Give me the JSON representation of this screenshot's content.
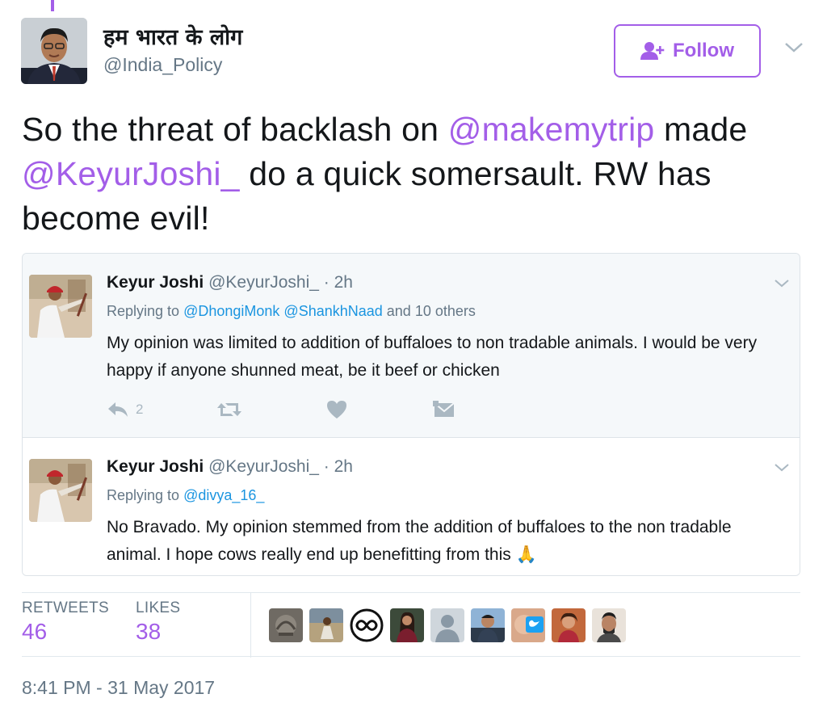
{
  "header": {
    "display_name": "हम भारत के लोग",
    "handle": "@India_Policy",
    "follow_label": "Follow"
  },
  "tweet": {
    "part1": "So the threat of backlash on ",
    "mention1": "@makemytrip",
    "part2": " made ",
    "mention2": "@KeyurJoshi_",
    "part3": " do a quick somersault. RW has become evil!"
  },
  "quoted": [
    {
      "name": "Keyur Joshi",
      "handle": "@KeyurJoshi_",
      "time": "· 2h",
      "replying_prefix": "Replying to ",
      "reply_link1": "@DhongiMonk",
      "reply_link2": "@ShankhNaad",
      "reply_suffix": " and 10 others",
      "text": "My opinion was limited to addition of buffaloes to non tradable animals. I would be very happy if anyone shunned meat, be it beef or chicken",
      "reply_count": "2"
    },
    {
      "name": "Keyur Joshi",
      "handle": "@KeyurJoshi_",
      "time": "· 2h",
      "replying_prefix": "Replying to ",
      "reply_link1": "@divya_16_",
      "text": "No Bravado. My opinion stemmed from the addition of buffaloes to the non tradable animal. I hope cows really end up benefitting from this 🙏"
    }
  ],
  "stats": {
    "retweets_label": "RETWEETS",
    "retweets_value": "46",
    "likes_label": "LIKES",
    "likes_value": "38"
  },
  "timestamp": "8:41 PM - 31 May 2017",
  "colors": {
    "accent": "#a35ee8",
    "link_blue": "#1b95e0",
    "muted": "#657786"
  }
}
